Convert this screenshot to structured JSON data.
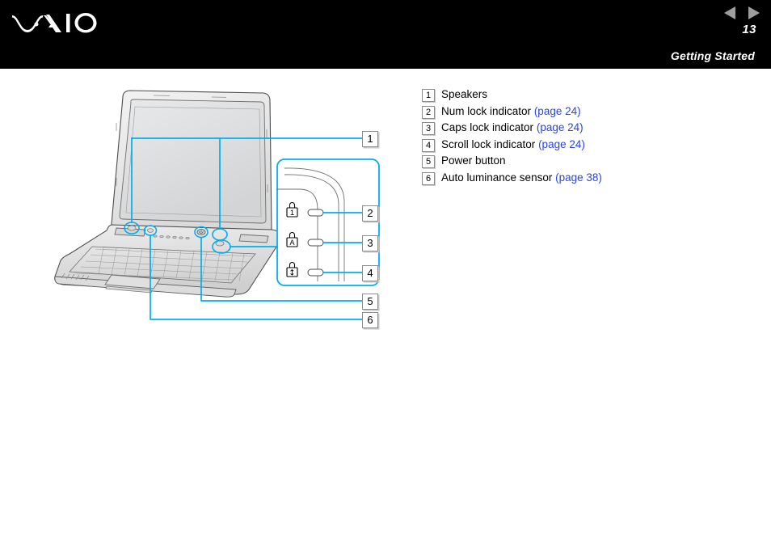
{
  "header": {
    "logo_text": "VAIO",
    "logo_icon": "vaio-logo",
    "prev_icon": "triangle-left-icon",
    "next_icon": "triangle-right-icon",
    "page_number": "13",
    "section_title": "Getting Started",
    "background_color": "#000000",
    "arrow_color": "#9d9d9d"
  },
  "legend": {
    "items": [
      {
        "number": "1",
        "label": "Speakers",
        "link": ""
      },
      {
        "number": "2",
        "label": "Num lock indicator",
        "link": "(page 24)"
      },
      {
        "number": "3",
        "label": "Caps lock indicator",
        "link": "(page 24)"
      },
      {
        "number": "4",
        "label": "Scroll lock indicator",
        "link": "(page 24)"
      },
      {
        "number": "5",
        "label": "Power button",
        "link": ""
      },
      {
        "number": "6",
        "label": "Auto luminance sensor",
        "link": "(page 38)"
      }
    ],
    "link_color": "#2a45dd"
  },
  "diagram": {
    "subject": "laptop-front-view-illustration",
    "callouts": [
      {
        "number": "1",
        "target": "speakers"
      },
      {
        "number": "2",
        "target": "num-lock-indicator"
      },
      {
        "number": "3",
        "target": "caps-lock-indicator"
      },
      {
        "number": "4",
        "target": "scroll-lock-indicator"
      },
      {
        "number": "5",
        "target": "power-button"
      },
      {
        "number": "6",
        "target": "auto-luminance-sensor"
      }
    ],
    "detail_panel": {
      "indicators": [
        {
          "icon": "num-lock-padlock-icon",
          "glyph": "1"
        },
        {
          "icon": "caps-lock-padlock-icon",
          "glyph": "A"
        },
        {
          "icon": "scroll-lock-padlock-icon",
          "glyph": "↕"
        }
      ]
    },
    "leader_line_color": "#00aeef",
    "outline_color": "#4d4d4d"
  }
}
